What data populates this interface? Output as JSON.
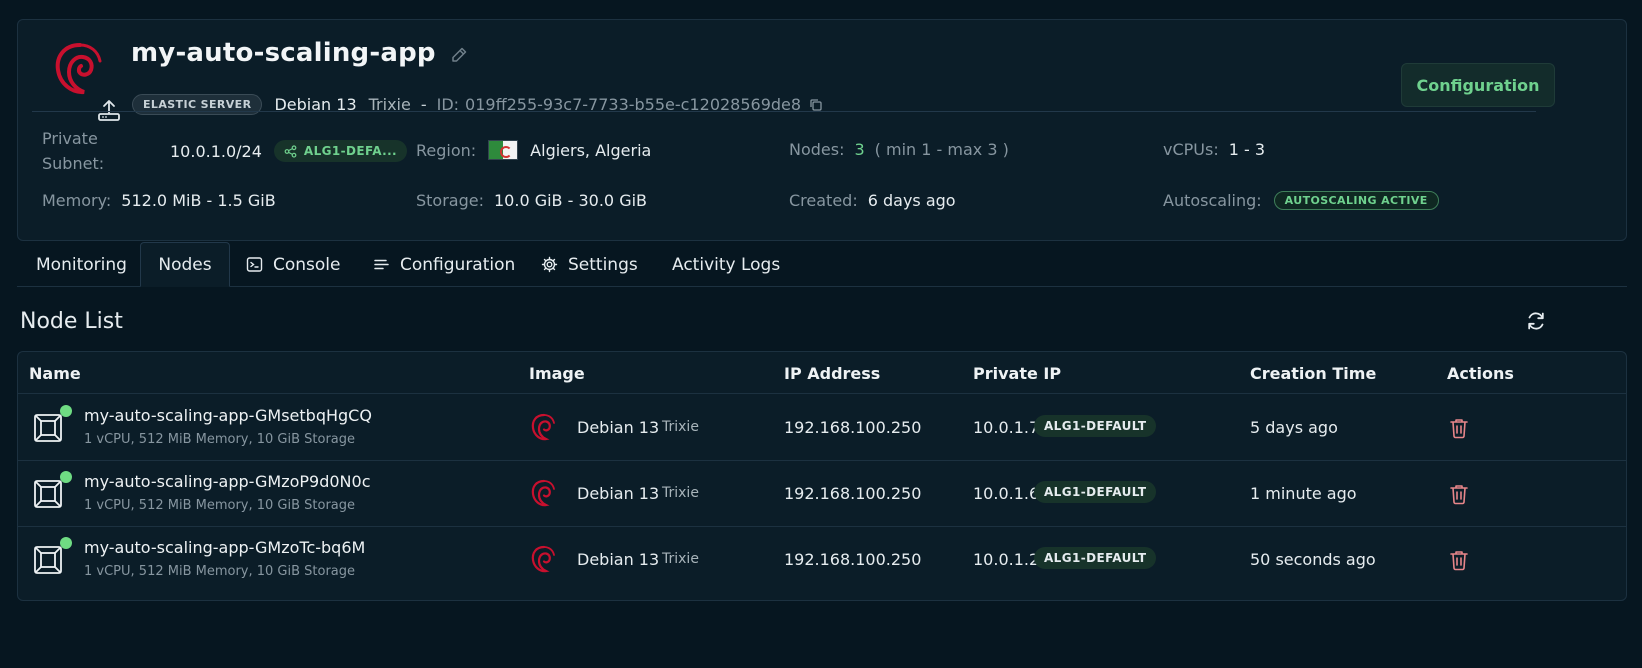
{
  "header": {
    "app_title": "my-auto-scaling-app",
    "server_type": "ELASTIC SERVER",
    "os_name": "Debian 13",
    "os_version": "Trixie",
    "separator": "-",
    "id_label": "ID:",
    "id_value": "019ff255-93c7-7733-b55e-c12028569de8",
    "config_button": "Configuration"
  },
  "info": {
    "private_subnet_label": "Private Subnet:",
    "private_subnet_value": "10.0.1.0/24",
    "subnet_badge": "ALG1-DEFA...",
    "region_label": "Region:",
    "region_value": "Algiers, Algeria",
    "nodes_label": "Nodes:",
    "nodes_value": "3",
    "nodes_range": "( min 1 - max 3 )",
    "vcpus_label": "vCPUs:",
    "vcpus_value": "1 - 3",
    "memory_label": "Memory:",
    "memory_value": "512.0 MiB - 1.5 GiB",
    "storage_label": "Storage:",
    "storage_value": "10.0 GiB - 30.0 GiB",
    "created_label": "Created:",
    "created_value": "6 days ago",
    "autoscaling_label": "Autoscaling:",
    "autoscaling_badge": "AUTOSCALING ACTIVE"
  },
  "tabs": [
    {
      "label": "Monitoring"
    },
    {
      "label": "Nodes"
    },
    {
      "label": "Console"
    },
    {
      "label": "Configuration"
    },
    {
      "label": "Settings"
    },
    {
      "label": "Activity Logs"
    }
  ],
  "node_list": {
    "title": "Node List",
    "columns": [
      "Name",
      "Image",
      "IP Address",
      "Private IP",
      "Creation Time",
      "Actions"
    ],
    "rows": [
      {
        "name": "my-auto-scaling-app-GMsetbqHgCQ",
        "spec": "1 vCPU, 512 MiB Memory, 10 GiB Storage",
        "image_os": "Debian 13",
        "image_ver": "Trixie",
        "ip": "192.168.100.250",
        "private_ip": "10.0.1.7",
        "subnet": "ALG1-DEFAULT",
        "created": "5 days ago"
      },
      {
        "name": "my-auto-scaling-app-GMzoP9d0N0c",
        "spec": "1 vCPU, 512 MiB Memory, 10 GiB Storage",
        "image_os": "Debian 13",
        "image_ver": "Trixie",
        "ip": "192.168.100.250",
        "private_ip": "10.0.1.6",
        "subnet": "ALG1-DEFAULT",
        "created": "1 minute ago"
      },
      {
        "name": "my-auto-scaling-app-GMzoTc-bq6M",
        "spec": "1 vCPU, 512 MiB Memory, 10 GiB Storage",
        "image_os": "Debian 13",
        "image_ver": "Trixie",
        "ip": "192.168.100.250",
        "private_ip": "10.0.1.2",
        "subnet": "ALG1-DEFAULT",
        "created": "50 seconds ago"
      }
    ]
  },
  "colors": {
    "background": "#061620",
    "card": "#0b1d28",
    "accent_green": "#6fd18e",
    "debian_red": "#c8102e",
    "trash_red": "#e8868a"
  }
}
